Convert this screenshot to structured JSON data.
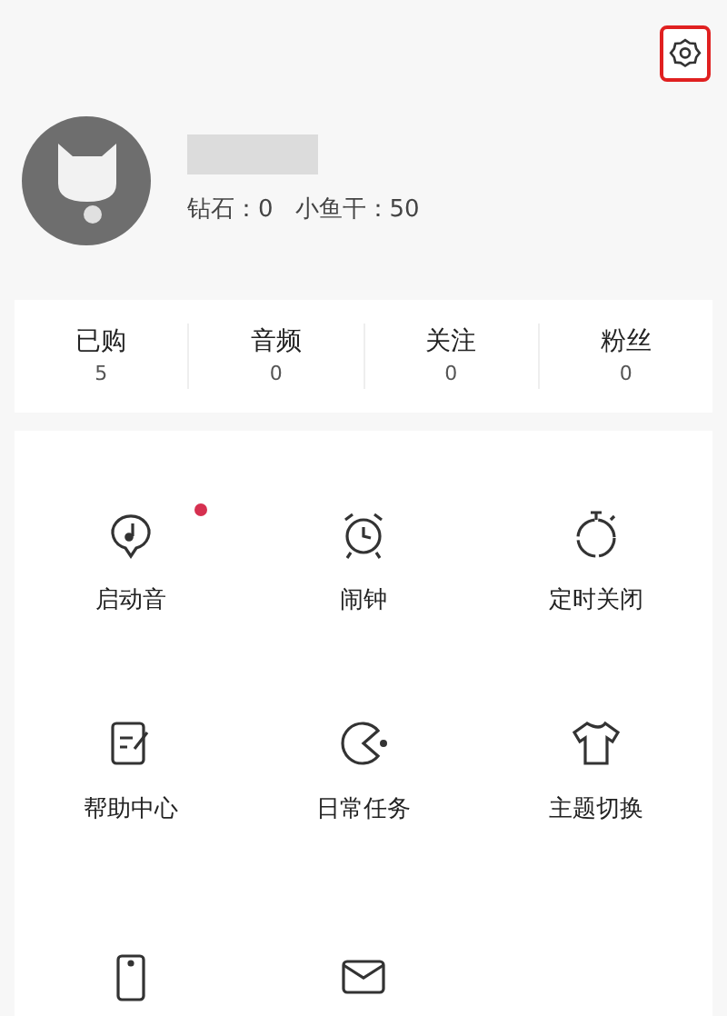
{
  "profile": {
    "diamonds_label": "钻石：0",
    "fish_label": "小鱼干：50"
  },
  "stats": [
    {
      "label": "已购",
      "value": "5"
    },
    {
      "label": "音频",
      "value": "0"
    },
    {
      "label": "关注",
      "value": "0"
    },
    {
      "label": "粉丝",
      "value": "0"
    }
  ],
  "menu": [
    {
      "kind": "music",
      "label": "启动音",
      "badge": true
    },
    {
      "kind": "alarm",
      "label": "闹钟",
      "badge": false
    },
    {
      "kind": "timer",
      "label": "定时关闭",
      "badge": false
    },
    {
      "kind": "help",
      "label": "帮助中心",
      "badge": false
    },
    {
      "kind": "task",
      "label": "日常任务",
      "badge": false
    },
    {
      "kind": "shirt",
      "label": "主题切换",
      "badge": false
    }
  ],
  "menu_more": [
    {
      "kind": "phone"
    },
    {
      "kind": "mail"
    }
  ]
}
